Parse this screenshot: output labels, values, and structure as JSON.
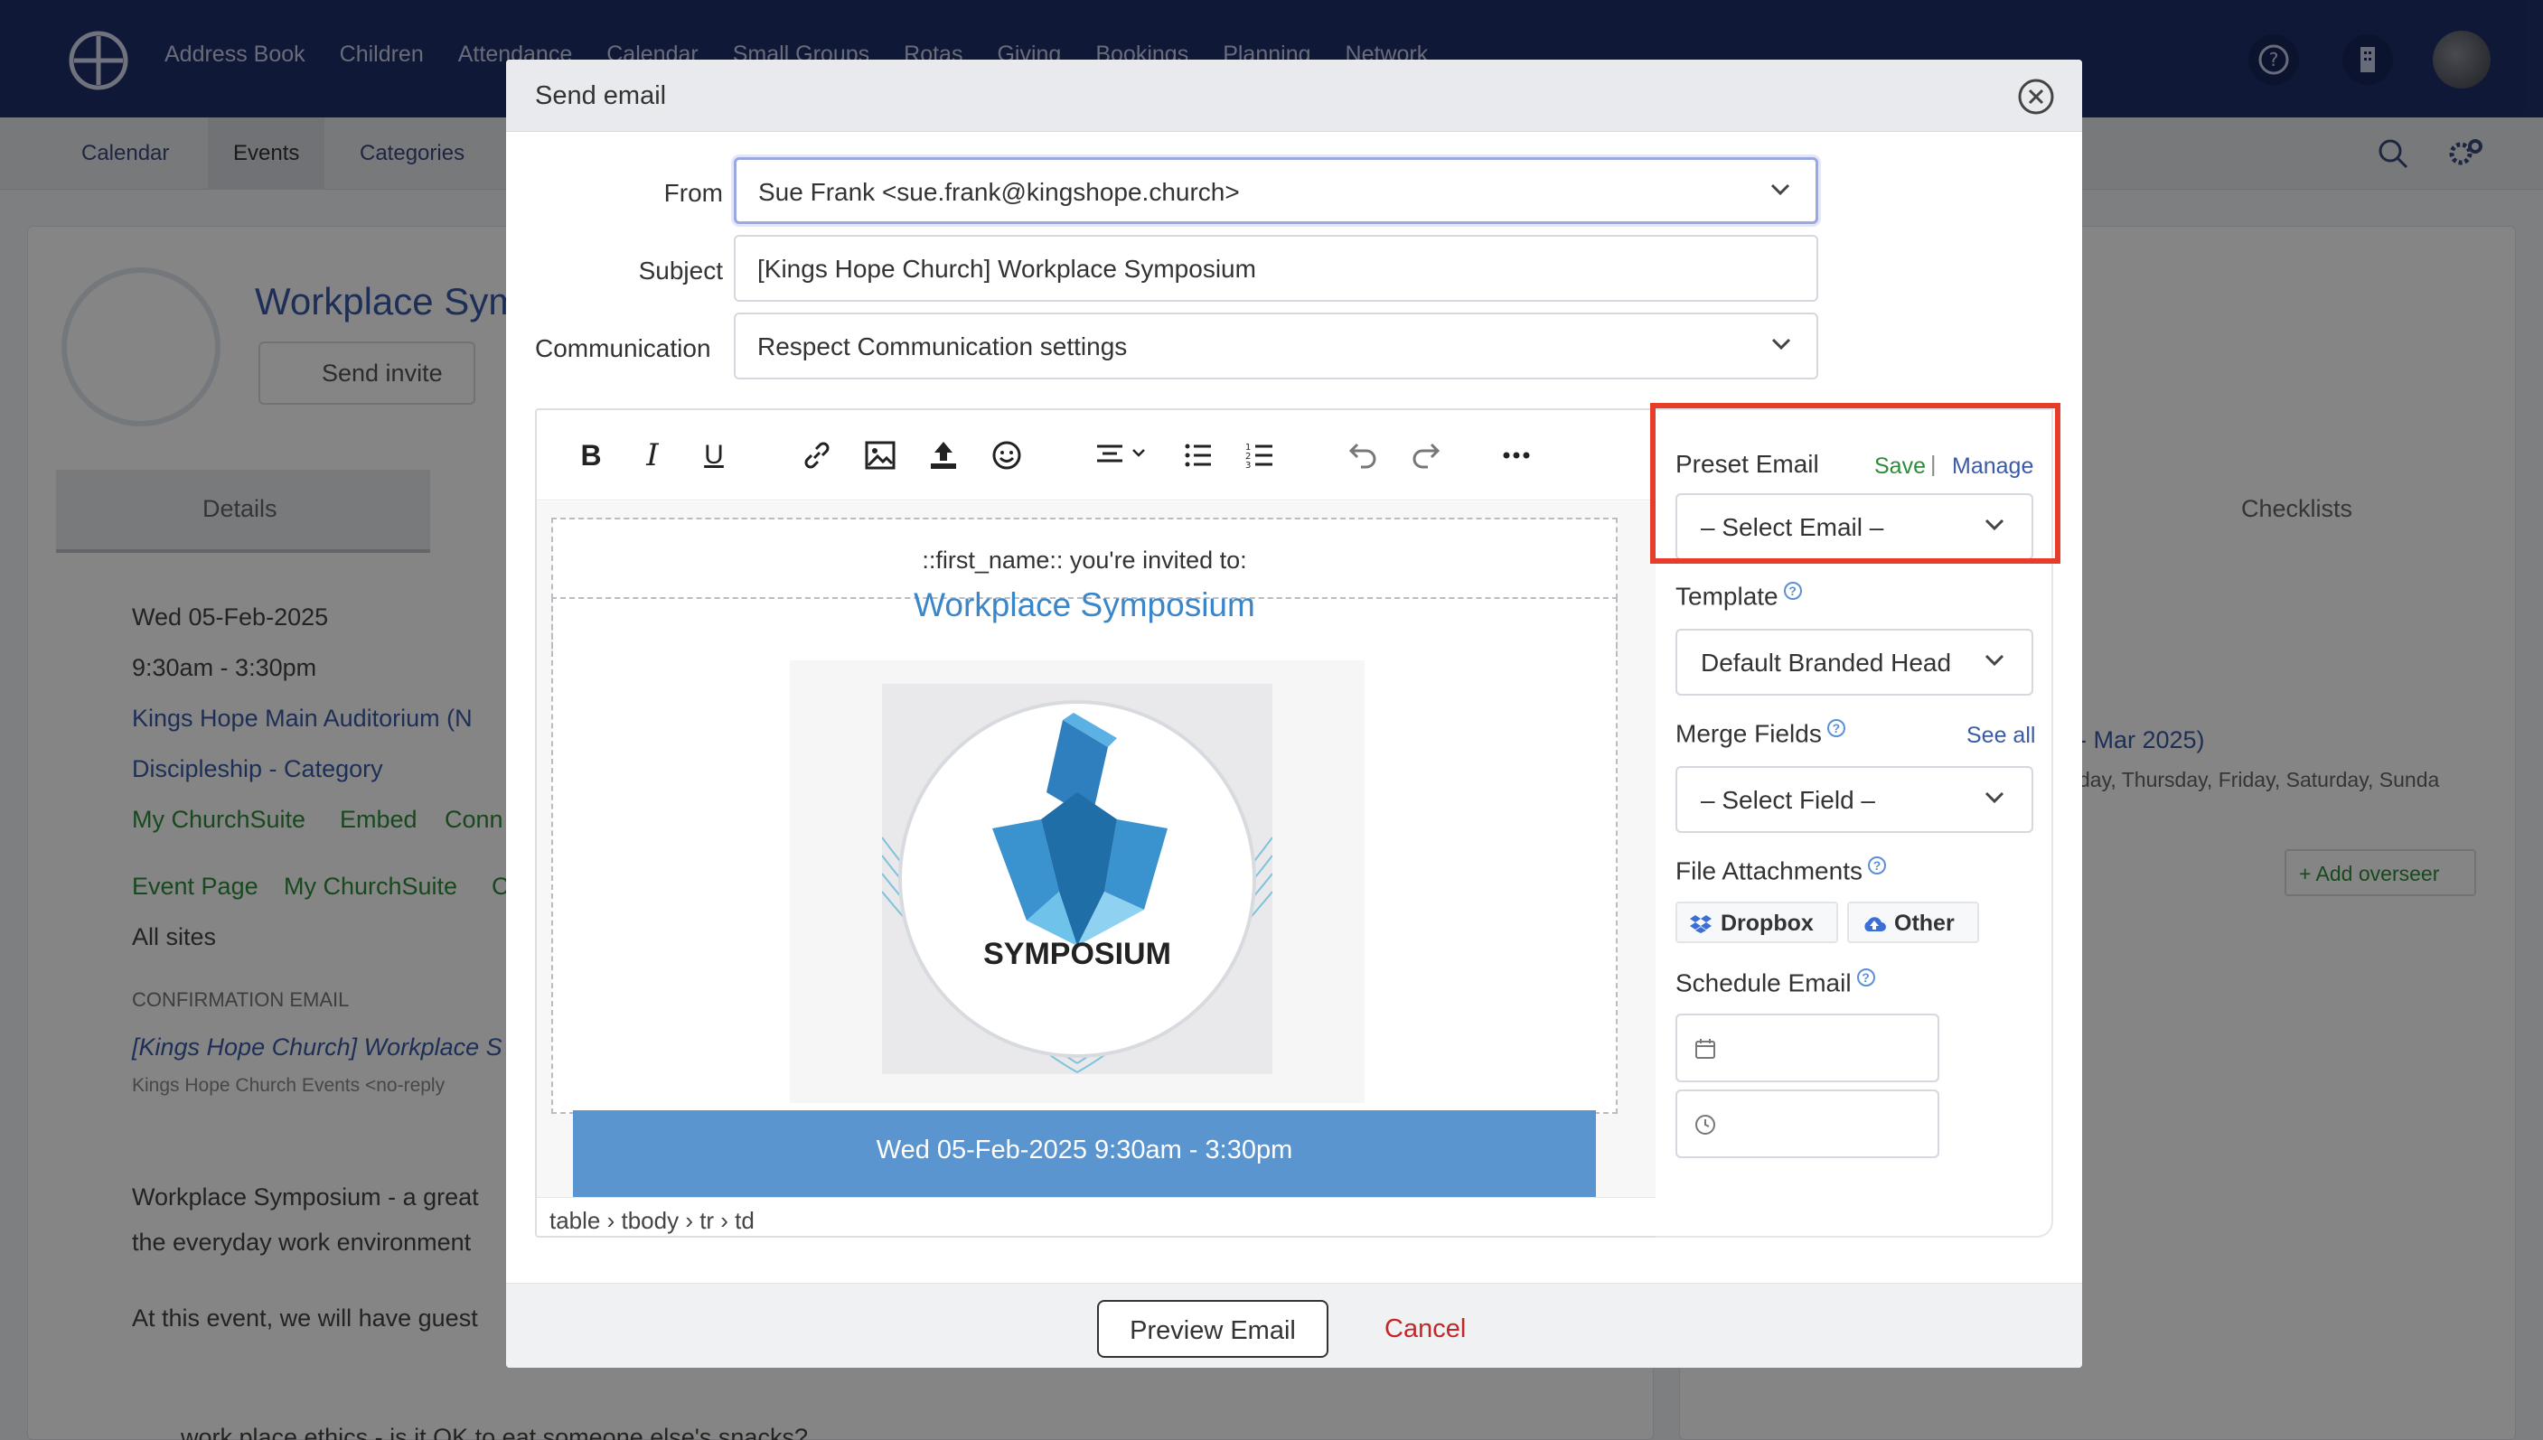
{
  "background": {
    "nav_links": [
      "Address Book",
      "Children",
      "Attendance",
      "Calendar",
      "Small Groups",
      "Rotas",
      "Giving",
      "Bookings",
      "Planning",
      "Network"
    ],
    "sub_tabs": [
      "Calendar",
      "Events",
      "Categories"
    ],
    "event_title": "Workplace Sym",
    "send_invite": "Send invite",
    "details_tab": "Details",
    "checklists_tab": "Checklists",
    "details": {
      "date": "Wed 05-Feb-2025",
      "time": "9:30am - 3:30pm",
      "location": "Kings Hope Main Auditorium (N",
      "category": "Discipleship - Category",
      "visibility": [
        "My ChurchSuite",
        "Embed",
        "Conn"
      ],
      "event_page": [
        "Event Page",
        "My ChurchSuite",
        "C"
      ],
      "sites": "All sites",
      "confirmation_heading": "CONFIRMATION EMAIL",
      "confirmation_subject": "[Kings Hope Church] Workplace S",
      "confirmation_from": "Kings Hope Church Events  <no-reply",
      "description_1": "Workplace Symposium - a great",
      "description_2": "the everyday work environment",
      "description_3": "At this event, we will have guest",
      "bullet": "work place ethics - is it OK to eat someone else's snacks?"
    },
    "right_panel": {
      "date_range": "- Mar 2025)",
      "days": "day, Thursday, Friday, Saturday, Sunda",
      "add_overseer": "+ Add overseer"
    }
  },
  "modal": {
    "title": "Send email",
    "from_label": "From",
    "from_value": "Sue Frank <sue.frank@kingshope.church>",
    "subject_label": "Subject",
    "subject_value": "[Kings Hope Church] Workplace Symposium",
    "communication_label": "Communication",
    "communication_value": "Respect Communication settings",
    "editor": {
      "invite_line": "::first_name:: you're invited to:",
      "event_title": "Workplace Symposium",
      "image_text": "SYMPOSIUM",
      "date_band": "Wed 05-Feb-2025 9:30am - 3:30pm",
      "status_path": "table › tbody › tr › td"
    },
    "side": {
      "preset_label": "Preset Email",
      "save_link": "Save",
      "separator": "|",
      "manage_link": "Manage",
      "preset_value": "– Select Email –",
      "template_label": "Template",
      "template_value": "Default Branded Head",
      "merge_label": "Merge Fields",
      "see_all": "See all",
      "merge_value": "– Select Field –",
      "attachments_label": "File Attachments",
      "dropbox": "Dropbox",
      "other": "Other",
      "schedule_label": "Schedule Email"
    },
    "preview_button": "Preview Email",
    "cancel_button": "Cancel"
  },
  "colors": {
    "nav_bg": "#1f2f6b",
    "highlight": "#e53d2a",
    "link": "#3a5aa8",
    "cancel": "#c0282a",
    "date_band": "#5a95cf"
  }
}
